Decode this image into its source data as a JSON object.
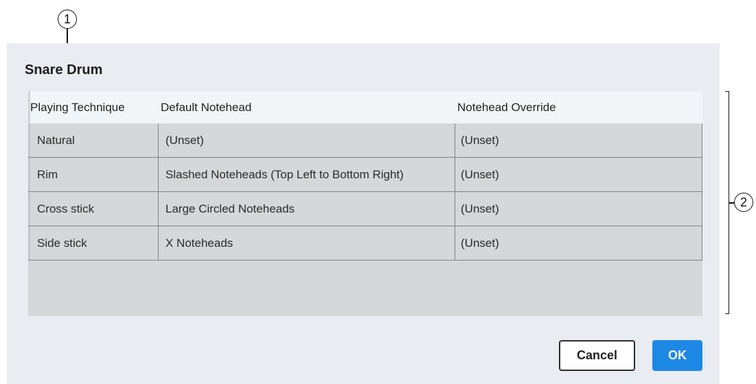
{
  "callouts": {
    "one": "1",
    "two": "2"
  },
  "dialog": {
    "title": "Snare Drum",
    "columns": [
      "Playing Technique",
      "Default Notehead",
      "Notehead Override"
    ],
    "rows": [
      [
        "Natural",
        "(Unset)",
        "(Unset)"
      ],
      [
        "Rim",
        "Slashed Noteheads (Top Left to Bottom Right)",
        "(Unset)"
      ],
      [
        "Cross stick",
        "Large Circled Noteheads",
        "(Unset)"
      ],
      [
        "Side stick",
        "X Noteheads",
        "(Unset)"
      ]
    ],
    "buttons": {
      "cancel": "Cancel",
      "ok": "OK"
    }
  },
  "colors": {
    "dialog_bg": "#e9ecf1",
    "table_bg": "#d5d7d9",
    "header_bg": "#f2f5f8",
    "ok_button": "#1e88e5"
  }
}
